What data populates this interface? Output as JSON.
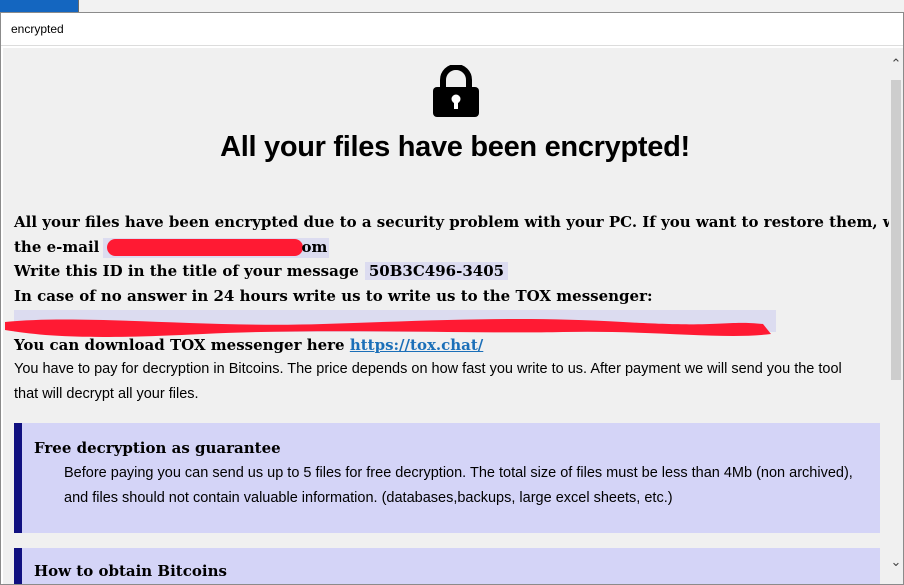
{
  "window": {
    "title": "encrypted"
  },
  "note": {
    "headline": "All your files have been encrypted!",
    "line1": "All your files have been encrypted due to a security problem with your PC. If you want to restore them, write us to",
    "email_label": "the e-mail",
    "email_suffix": "om",
    "id_label": "Write this ID in the title of your message",
    "id_value": "50B3C496-3405",
    "tox_label": "In case of no answer in 24 hours write us to write us to the TOX messenger:",
    "download_label": "You can download TOX messenger here",
    "download_link": "https://tox.chat/",
    "payment_line1": "You have to pay for decryption in Bitcoins. The price depends on how fast you write to us. After payment we will send you the tool",
    "payment_line2": "that will decrypt all your files."
  },
  "panels": [
    {
      "title": "Free decryption as guarantee",
      "body_line1": "Before paying you can send us up to 5 files for free decryption. The total size of files must be less than 4Mb (non archived),",
      "body_line2": "and files should not contain valuable information. (databases,backups, large excel sheets, etc.)"
    },
    {
      "title": "How to obtain Bitcoins"
    }
  ],
  "colors": {
    "panel_bg": "#d4d4f7",
    "panel_accent": "#101080",
    "redaction": "#ff1a33",
    "link": "#1b6fb8"
  },
  "icons": {
    "lock": "padlock-icon"
  }
}
